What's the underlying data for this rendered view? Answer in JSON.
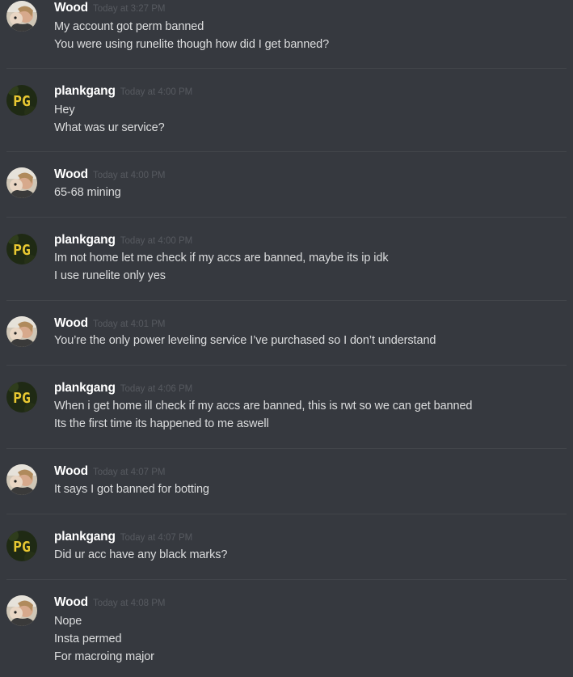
{
  "users": {
    "wood": {
      "name": "Wood",
      "avatar_icon": "wood-avatar-icon"
    },
    "plankgang": {
      "name": "plankgang",
      "avatar_icon": "plankgang-pg-avatar-icon",
      "avatar_text": "PG"
    }
  },
  "colors": {
    "background": "#36393f",
    "username": "#ffffff",
    "timestamp": "#575a60",
    "message_text": "#dcddde",
    "divider": "#42454a",
    "pg_avatar_bg": "#1f2a14",
    "pg_avatar_text": "#e8c832"
  },
  "messages": [
    {
      "author": "Wood",
      "timestamp": "Today at 3:27 PM",
      "lines": [
        "My account got perm banned",
        "You were using runelite though how did I get banned?"
      ]
    },
    {
      "author": "plankgang",
      "timestamp": "Today at 4:00 PM",
      "lines": [
        "Hey",
        "What was ur service?"
      ]
    },
    {
      "author": "Wood",
      "timestamp": "Today at 4:00 PM",
      "lines": [
        "65-68 mining"
      ]
    },
    {
      "author": "plankgang",
      "timestamp": "Today at 4:00 PM",
      "lines": [
        "Im not home let me check if my accs are banned, maybe its ip idk",
        "I use runelite only yes"
      ]
    },
    {
      "author": "Wood",
      "timestamp": "Today at 4:01 PM",
      "lines": [
        "You’re the only power leveling service I’ve purchased so I don’t understand"
      ]
    },
    {
      "author": "plankgang",
      "timestamp": "Today at 4:06 PM",
      "lines": [
        "When i get home ill check if my accs are banned, this is rwt so we can get banned",
        "Its the first time its happened to me aswell"
      ]
    },
    {
      "author": "Wood",
      "timestamp": "Today at 4:07 PM",
      "lines": [
        "It says I got banned for botting"
      ]
    },
    {
      "author": "plankgang",
      "timestamp": "Today at 4:07 PM",
      "lines": [
        "Did ur acc have any black marks?"
      ]
    },
    {
      "author": "Wood",
      "timestamp": "Today at 4:08 PM",
      "lines": [
        "Nope",
        "Insta permed",
        "For macroing major"
      ]
    }
  ]
}
